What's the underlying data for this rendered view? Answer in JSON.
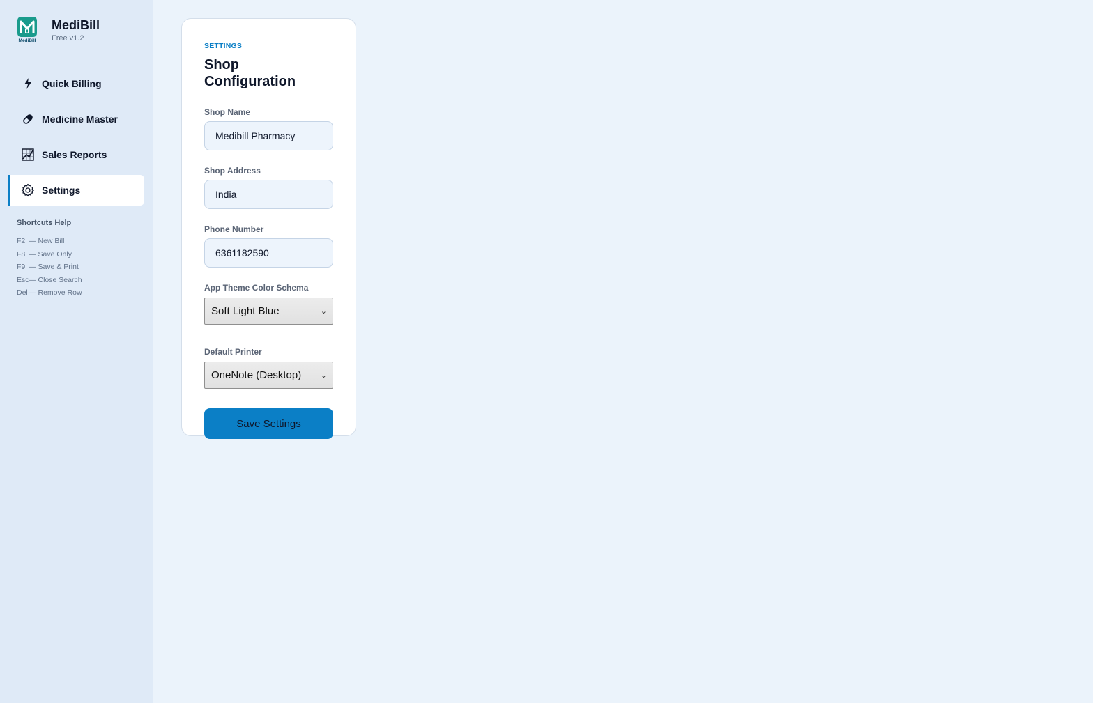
{
  "brand": {
    "name": "MediBill",
    "version": "Free v1.2",
    "logo_letter": "M",
    "logo_caption": "MediBill"
  },
  "nav": {
    "items": [
      {
        "label": "Quick Billing",
        "icon": "lightning-icon"
      },
      {
        "label": "Medicine Master",
        "icon": "pill-icon"
      },
      {
        "label": "Sales Reports",
        "icon": "chart-icon"
      },
      {
        "label": "Settings",
        "icon": "gear-icon",
        "active": true
      }
    ]
  },
  "shortcuts": {
    "title": "Shortcuts Help",
    "items": [
      {
        "key": "F2",
        "action": "New Bill"
      },
      {
        "key": "F8",
        "action": "Save Only"
      },
      {
        "key": "F9",
        "action": "Save & Print"
      },
      {
        "key": "Esc",
        "action": "Close Search"
      },
      {
        "key": "Del",
        "action": "Remove Row"
      }
    ],
    "separator": "—"
  },
  "settings": {
    "eyebrow": "SETTINGS",
    "title": "Shop Configuration",
    "shop_name": {
      "label": "Shop Name",
      "value": "Medibill Pharmacy"
    },
    "shop_address": {
      "label": "Shop Address",
      "value": "India"
    },
    "phone": {
      "label": "Phone Number",
      "value": "6361182590"
    },
    "theme": {
      "label": "App Theme Color Schema",
      "value": "Soft Light Blue"
    },
    "printer": {
      "label": "Default Printer",
      "value": "OneNote (Desktop)"
    },
    "save_label": "Save Settings"
  },
  "colors": {
    "accent": "#0b7fc6",
    "sidebar_bg": "#dfeaf7",
    "page_bg": "#ebf3fb",
    "logo_bg": "#1a9b8c"
  }
}
